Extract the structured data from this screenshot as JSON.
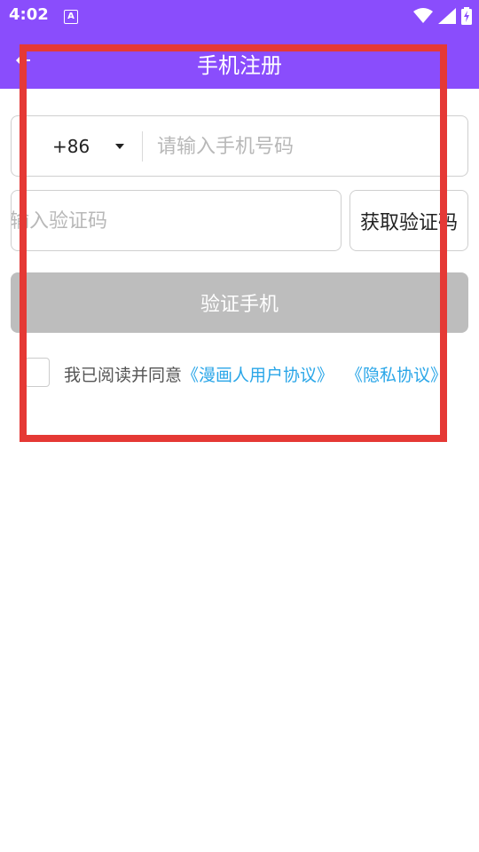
{
  "statusbar": {
    "time": "4:02",
    "app_badge": "A"
  },
  "header": {
    "title": "手机注册",
    "background_color": "#8a4dfc"
  },
  "form": {
    "country_code": "+86",
    "phone_placeholder": "请输入手机号码",
    "code_placeholder": "输入验证码",
    "get_code_label": "获取验证码",
    "verify_label": "验证手机"
  },
  "agreement": {
    "prefix": "我已阅读并同意",
    "user_protocol": "《漫画人用户协议》",
    "privacy_protocol": "《隐私协议》",
    "checked": false,
    "link_color": "#2aa6e8"
  },
  "icons": {
    "status": [
      "wifi-icon",
      "signal-icon",
      "battery-charging-icon"
    ],
    "back": "back-arrow-icon"
  },
  "highlight_color": "#e53935"
}
